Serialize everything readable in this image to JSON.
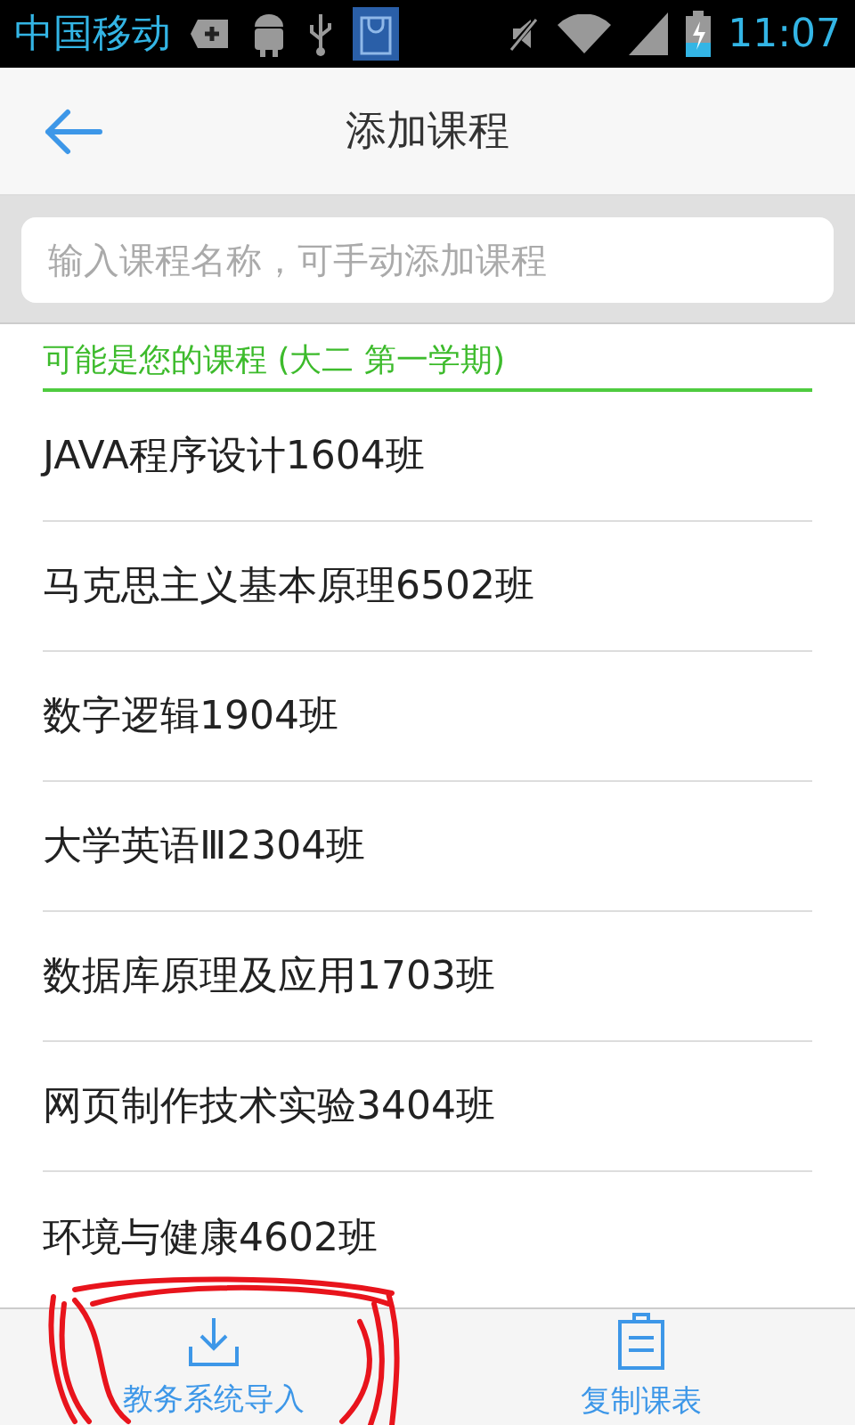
{
  "status_bar": {
    "carrier": "中国移动",
    "time": "11:07"
  },
  "header": {
    "title": "添加课程"
  },
  "search": {
    "placeholder": "输入课程名称，可手动添加课程"
  },
  "section": {
    "title": "可能是您的课程 (大二 第一学期)"
  },
  "courses": [
    {
      "name": "JAVA程序设计1604班"
    },
    {
      "name": "马克思主义基本原理6502班"
    },
    {
      "name": "数字逻辑1904班"
    },
    {
      "name": "大学英语Ⅲ2304班"
    },
    {
      "name": "数据库原理及应用1703班"
    },
    {
      "name": "网页制作技术实验3404班"
    },
    {
      "name": "环境与健康4602班"
    }
  ],
  "bottom_bar": [
    {
      "kind": "import",
      "label": "教务系统导入"
    },
    {
      "kind": "copy",
      "label": "复制课表"
    }
  ],
  "annotation": {
    "kind": "scribble"
  }
}
